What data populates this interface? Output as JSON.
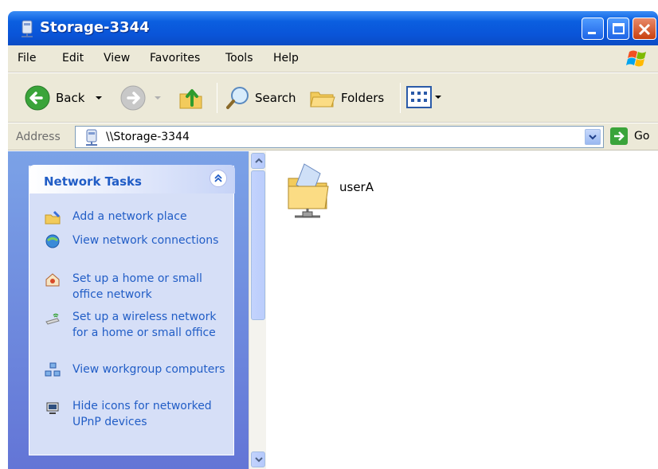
{
  "window": {
    "title": "Storage-3344"
  },
  "menu": {
    "items": [
      "File",
      "Edit",
      "View",
      "Favorites",
      "Tools",
      "Help"
    ]
  },
  "toolbar": {
    "back_label": "Back",
    "search_label": "Search",
    "folders_label": "Folders"
  },
  "address": {
    "label": "Address",
    "value": "\\\\Storage-3344",
    "go_label": "Go"
  },
  "task_pane": {
    "title": "Network Tasks",
    "tasks": [
      {
        "label": "Add a network place",
        "icon": "add-network-place-icon"
      },
      {
        "label": "View network connections",
        "icon": "network-connections-icon"
      },
      {
        "label": "Set up a home or small office network",
        "icon": "home-network-icon"
      },
      {
        "label": "Set up a wireless network for a home or small office",
        "icon": "wireless-network-icon"
      },
      {
        "label": "View workgroup computers",
        "icon": "workgroup-icon"
      },
      {
        "label": "Hide icons for networked UPnP devices",
        "icon": "upnp-icon"
      }
    ]
  },
  "content": {
    "items": [
      {
        "name": "userA",
        "icon": "shared-folder-icon"
      }
    ]
  },
  "colors": {
    "title_bar": "#0a54d8",
    "task_link": "#215dc6",
    "chrome": "#ece9d8"
  }
}
